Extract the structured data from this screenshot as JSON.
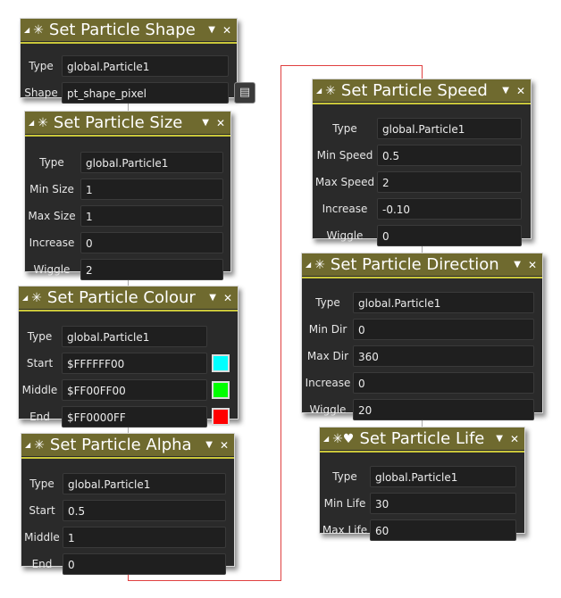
{
  "blocks": [
    {
      "title": "Set Particle Shape",
      "rows": [
        {
          "label": "Type",
          "value": "global.Particle1"
        },
        {
          "label": "Shape",
          "value": "pt_shape_pixel",
          "button": "menu-icon"
        }
      ]
    },
    {
      "title": "Set Particle Size",
      "rows": [
        {
          "label": "Type",
          "value": "global.Particle1"
        },
        {
          "label": "Min Size",
          "value": "1"
        },
        {
          "label": "Max Size",
          "value": "1"
        },
        {
          "label": "Increase",
          "value": "0"
        },
        {
          "label": "Wiggle",
          "value": "2"
        }
      ]
    },
    {
      "title": "Set Particle Colour",
      "rows": [
        {
          "label": "Type",
          "value": "global.Particle1"
        },
        {
          "label": "Start",
          "value": "$FFFFFF00",
          "swatch": "#00ffff"
        },
        {
          "label": "Middle",
          "value": "$FF00FF00",
          "swatch": "#00ff00"
        },
        {
          "label": "End",
          "value": "$FF0000FF",
          "swatch": "#ff0000"
        }
      ]
    },
    {
      "title": "Set Particle Alpha",
      "rows": [
        {
          "label": "Type",
          "value": "global.Particle1"
        },
        {
          "label": "Start",
          "value": "0.5"
        },
        {
          "label": "Middle",
          "value": "1"
        },
        {
          "label": "End",
          "value": "0"
        }
      ]
    },
    {
      "title": "Set Particle Speed",
      "rows": [
        {
          "label": "Type",
          "value": "global.Particle1"
        },
        {
          "label": "Min Speed",
          "value": "0.5"
        },
        {
          "label": "Max Speed",
          "value": "2"
        },
        {
          "label": "Increase",
          "value": "-0.10"
        },
        {
          "label": "Wiggle",
          "value": "0"
        }
      ]
    },
    {
      "title": "Set Particle Direction",
      "rows": [
        {
          "label": "Type",
          "value": "global.Particle1"
        },
        {
          "label": "Min Dir",
          "value": "0"
        },
        {
          "label": "Max Dir",
          "value": "360"
        },
        {
          "label": "Increase",
          "value": "0"
        },
        {
          "label": "Wiggle",
          "value": "20"
        }
      ]
    },
    {
      "title": "Set Particle Life",
      "icon": "heart-particle-icon",
      "rows": [
        {
          "label": "Type",
          "value": "global.Particle1"
        },
        {
          "label": "Min Life",
          "value": "30"
        },
        {
          "label": "Max Life",
          "value": "60"
        }
      ]
    }
  ],
  "colors": {
    "header": "#6f6a2f",
    "accent_line": "#c9c63a",
    "flow_link": "#e04040",
    "connector": "#aaaaaa"
  }
}
